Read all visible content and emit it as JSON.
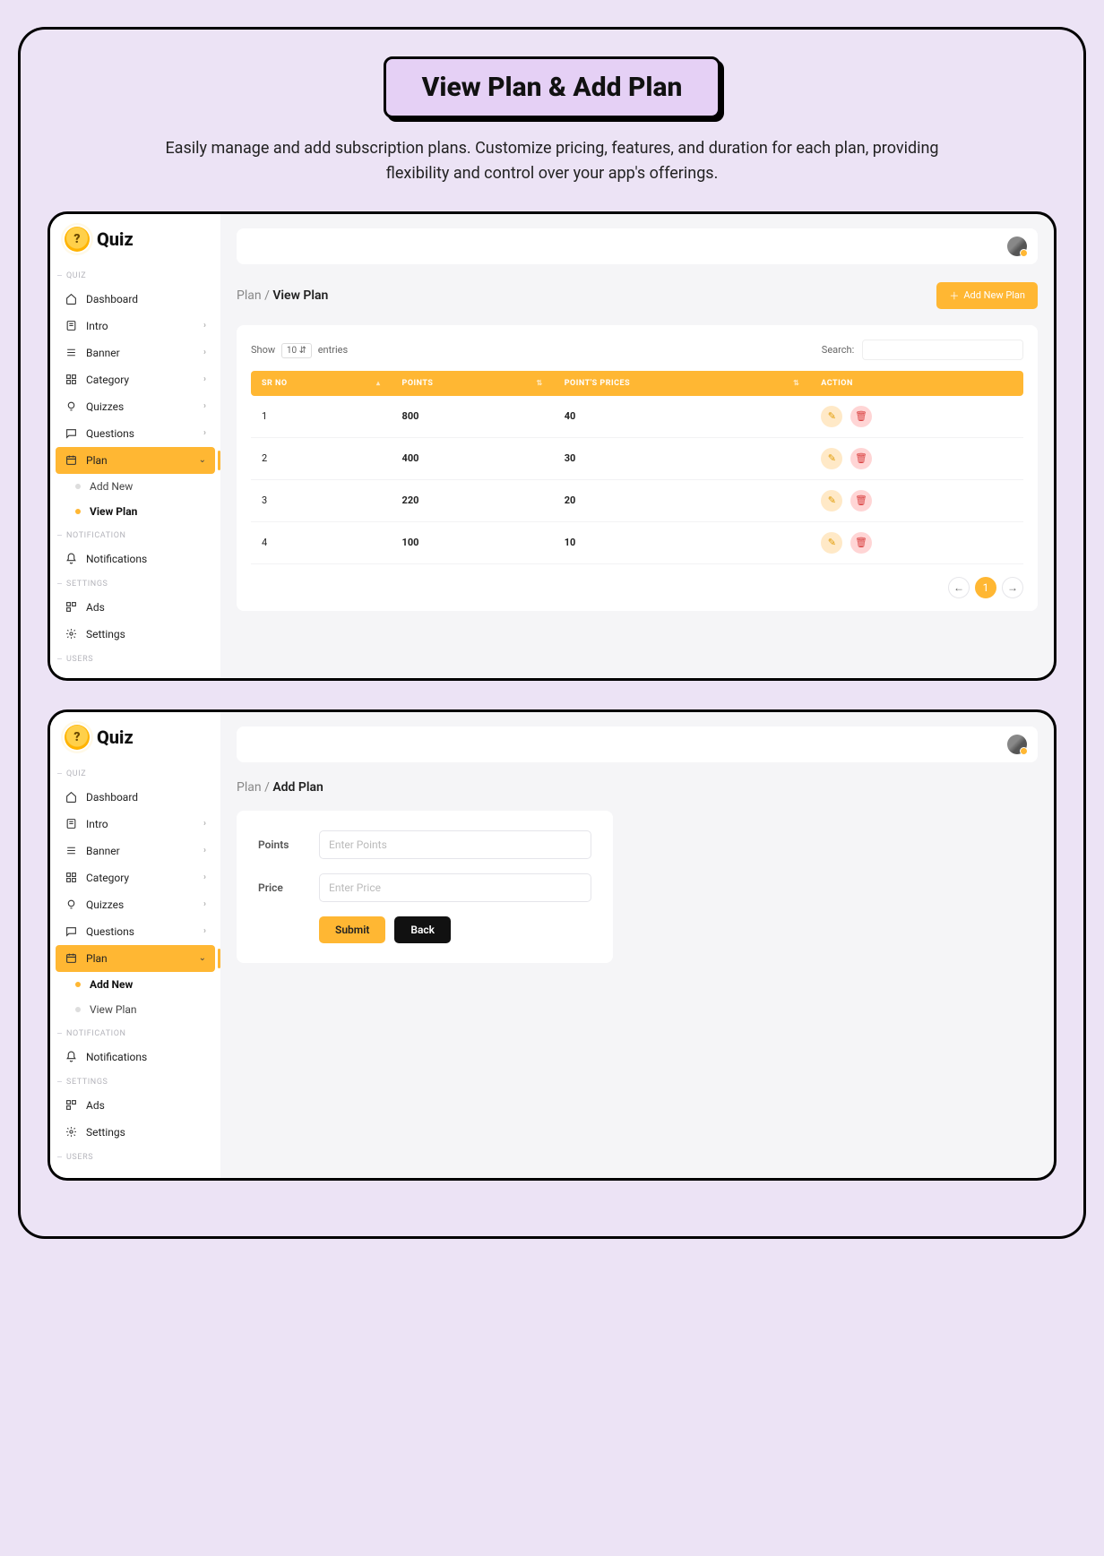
{
  "hero": {
    "title": "View Plan & Add Plan",
    "desc": "Easily manage and add subscription plans. Customize pricing, features, and duration for each plan, providing flexibility and control over your app's offerings."
  },
  "brand": {
    "name": "Quiz",
    "mark": "?"
  },
  "sections": {
    "quiz": "QUIZ",
    "notification": "NOTIFICATION",
    "settings": "SETTINGS",
    "users": "USERS"
  },
  "nav": {
    "dashboard": "Dashboard",
    "intro": "Intro",
    "banner": "Banner",
    "category": "Category",
    "quizzes": "Quizzes",
    "questions": "Questions",
    "plan": "Plan",
    "plan_add": "Add New",
    "plan_view": "View Plan",
    "notifications": "Notifications",
    "ads": "Ads",
    "settings": "Settings"
  },
  "view": {
    "crumb_root": "Plan",
    "crumb_sep": " / ",
    "crumb_cur": "View Plan",
    "add_btn": "Add New Plan",
    "show_label": "Show",
    "show_value": "10",
    "entries_label": "entries",
    "search_label": "Search:",
    "cols": {
      "sr": "SR NO",
      "points": "POINTS",
      "prices": "POINT'S PRICES",
      "action": "ACTION"
    },
    "rows": [
      {
        "sr": "1",
        "points": "800",
        "price": "40"
      },
      {
        "sr": "2",
        "points": "400",
        "price": "30"
      },
      {
        "sr": "3",
        "points": "220",
        "price": "20"
      },
      {
        "sr": "4",
        "points": "100",
        "price": "10"
      }
    ],
    "pager": {
      "prev": "←",
      "page": "1",
      "next": "→"
    }
  },
  "add": {
    "crumb_root": "Plan",
    "crumb_sep": " / ",
    "crumb_cur": "Add Plan",
    "points_label": "Points",
    "points_ph": "Enter Points",
    "price_label": "Price",
    "price_ph": "Enter Price",
    "submit": "Submit",
    "back": "Back"
  }
}
